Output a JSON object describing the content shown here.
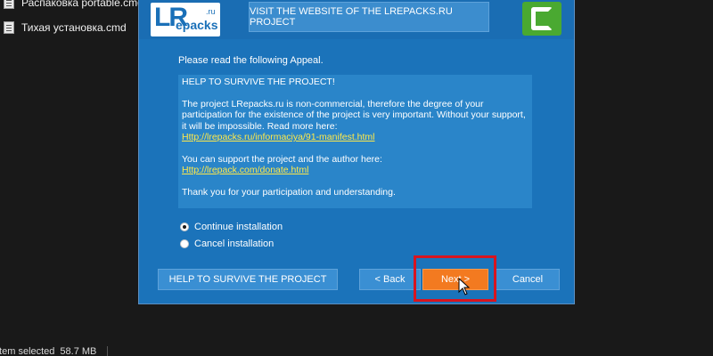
{
  "explorer": {
    "files": [
      {
        "name": "Распаковка portable.cmd"
      },
      {
        "name": "Тихая установка.cmd"
      }
    ],
    "status": {
      "selection": "Item selected",
      "size": "58.7 MB"
    }
  },
  "installer": {
    "logo": {
      "lr": "LR",
      "repacks": "epacks",
      "ru": ".ru"
    },
    "visit_banner": "VISIT THE WEBSITE OF THE LREPACKS.RU PROJECT",
    "app_logo_icon": "camtasia-logo-icon",
    "intro": "Please read the following Appeal.",
    "appeal": {
      "heading": "HELP TO SURVIVE THE PROJECT!",
      "paragraph1": "The project LRepacks.ru is non-commercial, therefore the degree of your participation for the existence of the project is very important. Without your support, it will be impossible. Read more here:",
      "link1": "Http://lrepacks.ru/informaciya/91-manifest.html",
      "paragraph2": "You can support the project and the author here:",
      "link2": "Http://lrepack.com/donate.html",
      "paragraph3": "Thank you for your participation and understanding."
    },
    "options": [
      {
        "label": "Continue installation",
        "selected": true
      },
      {
        "label": "Cancel installation",
        "selected": false
      }
    ],
    "buttons": {
      "help": "HELP TO SURVIVE THE PROJECT",
      "back": "< Back",
      "next": "Next >",
      "cancel": "Cancel"
    },
    "colors": {
      "window_bg": "#1b73ba",
      "accent_next": "#f37a20",
      "highlight": "#d8141f",
      "link": "#ffe94a"
    }
  }
}
